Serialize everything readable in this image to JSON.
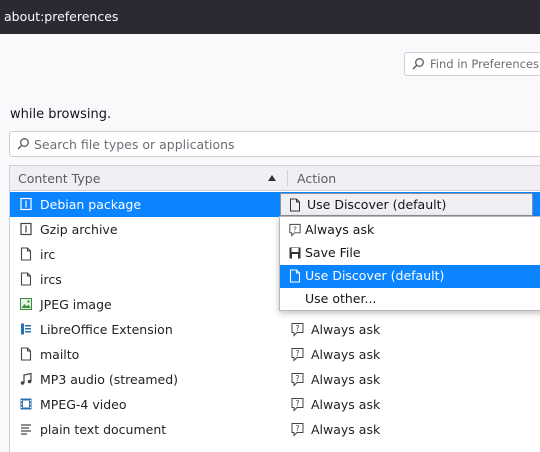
{
  "window": {
    "title": "about:preferences"
  },
  "search": {
    "placeholder": "Find in Preferences"
  },
  "applications": {
    "intro_text": "while browsing.",
    "filter_placeholder": "Search file types or applications",
    "columns": {
      "content_type": "Content Type",
      "action": "Action",
      "sort": "ascending"
    },
    "rows": [
      {
        "type": "Debian package",
        "icon": "package-icon",
        "action": "Use Discover (default)",
        "selected": true
      },
      {
        "type": "Gzip archive",
        "icon": "archive-icon",
        "action": ""
      },
      {
        "type": "irc",
        "icon": "document-icon",
        "action": ""
      },
      {
        "type": "ircs",
        "icon": "document-icon",
        "action": ""
      },
      {
        "type": "JPEG image",
        "icon": "image-icon",
        "action": ""
      },
      {
        "type": "LibreOffice Extension",
        "icon": "extension-icon",
        "action": "Always ask",
        "action_icon": "ask-icon"
      },
      {
        "type": "mailto",
        "icon": "document-icon",
        "action": "Always ask",
        "action_icon": "ask-icon"
      },
      {
        "type": "MP3 audio (streamed)",
        "icon": "music-icon",
        "action": "Always ask",
        "action_icon": "ask-icon"
      },
      {
        "type": "MPEG-4 video",
        "icon": "video-icon",
        "action": "Always ask",
        "action_icon": "ask-icon"
      },
      {
        "type": "plain text document",
        "icon": "text-icon",
        "action": "Always ask",
        "action_icon": "ask-icon"
      }
    ],
    "dropdown": {
      "items": [
        {
          "label": "Always ask",
          "icon": "ask-icon"
        },
        {
          "label": "Save File",
          "icon": "save-icon"
        },
        {
          "label": "Use Discover (default)",
          "icon": "document-icon",
          "highlighted": true
        },
        {
          "label": "Use other...",
          "icon": ""
        }
      ]
    }
  },
  "colors": {
    "accent": "#0a84ff",
    "titlebar": "#2b2a33"
  }
}
